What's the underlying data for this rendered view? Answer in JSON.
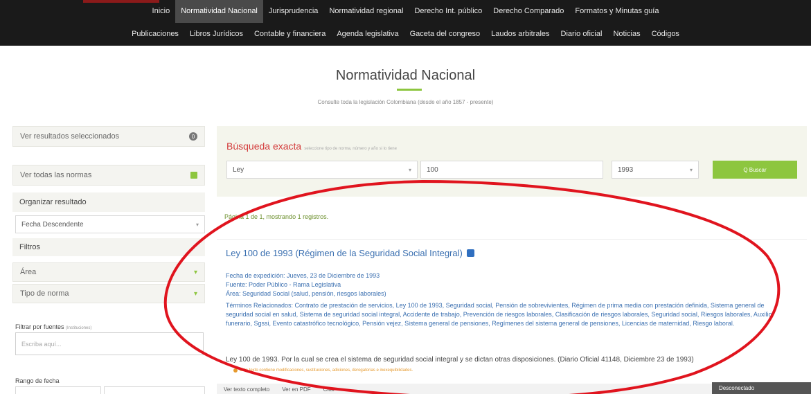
{
  "nav": {
    "row1": [
      "Inicio",
      "Normatividad Nacional",
      "Jurisprudencia",
      "Normatividad regional",
      "Derecho Int. público",
      "Derecho Comparado",
      "Formatos y Minutas guía"
    ],
    "row2": [
      "Publicaciones",
      "Libros Jurídicos",
      "Contable y financiera",
      "Agenda legislativa",
      "Gaceta del congreso",
      "Laudos arbitrales",
      "Diario oficial",
      "Noticias",
      "Códigos"
    ],
    "active": "Normatividad Nacional"
  },
  "page": {
    "title": "Normatividad Nacional",
    "subtitle": "Consulte toda la legislación Colombiana (desde el año 1857 - presente)"
  },
  "sidebar": {
    "selected_results": "Ver resultados seleccionados",
    "selected_count": "0",
    "all_norms": "Ver todas las normas",
    "organize_label": "Organizar resultado",
    "sort_value": "Fecha Descendente",
    "filters_label": "Filtros",
    "area_label": "Área",
    "type_label": "Tipo de norma",
    "source_filter_label": "Filtrar por fuentes",
    "source_filter_hint": "(Instituciones)",
    "source_placeholder": "Escriba aquí...",
    "date_range_label": "Rango de fecha"
  },
  "search": {
    "title": "Búsqueda exacta",
    "hint": "seleccione tipo de norma, número y año si lo tiene",
    "type_value": "Ley",
    "number_value": "100",
    "year_value": "1993",
    "button_label": "Q Buscar"
  },
  "results": {
    "page_info": "Página 1 de 1, mostrando 1 registros.",
    "item": {
      "title": "Ley 100 de 1993 (Régimen de la Seguridad Social Integral)",
      "date": "Fecha de expedición: Jueves, 23 de Diciembre de 1993",
      "source": "Fuente: Poder Público - Rama Legislativa",
      "area": "Área: Seguridad Social (salud, pensión, riesgos laborales)",
      "terms": "Términos Relacionados: Contrato de prestación de servicios, Ley 100 de 1993, Seguridad social, Pensión de sobrevivientes, Régimen de prima media con prestación definida, Sistema general de seguridad social en salud, Sistema de seguridad social integral, Accidente de trabajo, Prevención de riesgos laborales, Clasificación de riesgos laborales, Seguridad social, Riesgos laborales, Auxilio funerario, Sgssi, Evento catastrófico tecnológico, Pensión vejez, Sistema general de pensiones, Regímenes del sistema general de pensiones, Licencias de maternidad, Riesgo laboral.",
      "description": "Ley 100 de 1993. Por la cual se crea el sistema de seguridad social integral y se dictan otras disposiciones. (Diario Oficial 41148, Diciembre 23 de 1993)",
      "note": "Este texto contiene modificaciones, sustituciones, adiciones, derogatorias e inexequibilidades.",
      "actions": [
        "Ver texto completo",
        "Ver en PDF",
        "Citar"
      ]
    }
  },
  "status": {
    "label": "Desconectado"
  },
  "colors": {
    "accent": "#8dc63f",
    "search_title": "#d33c3c",
    "link": "#3a6fb0",
    "annotation": "#e0141e"
  }
}
